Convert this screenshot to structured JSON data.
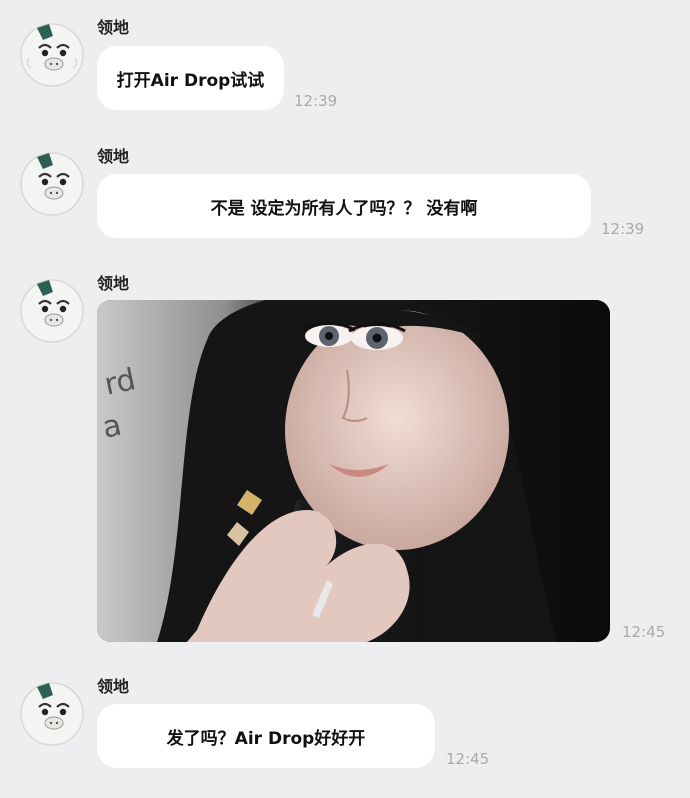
{
  "messages": [
    {
      "sender": "领地",
      "text": "打开Air Drop试试",
      "time": "12:39"
    },
    {
      "sender": "领地",
      "text": "不是 设定为所有人了吗？？ 没有啊",
      "time": "12:39"
    },
    {
      "sender": "领地",
      "image": "photo-of-girl-making-heart-hands",
      "time": "12:45"
    },
    {
      "sender": "领地",
      "text": "发了吗？Air Drop好好开",
      "time": "12:45"
    }
  ],
  "colors": {
    "background": "#eeeef0",
    "bubble": "#ffffff",
    "timestamp": "#a9a9ad",
    "avatar_hair": "#2e5f55"
  }
}
